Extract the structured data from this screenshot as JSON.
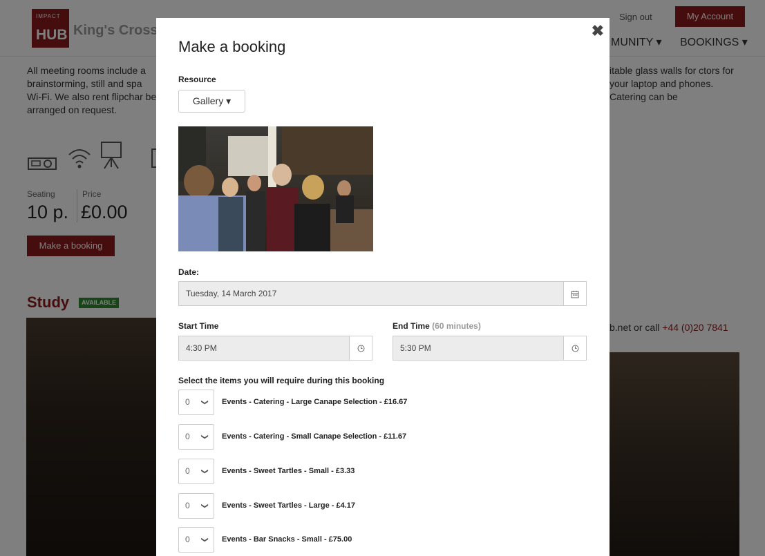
{
  "header": {
    "logo_small": "IMPACT",
    "logo_big": "HUB",
    "site_name": "King's Cross",
    "sign_out": "Sign out",
    "my_account": "My Account",
    "nav_community": "MUNITY ▾",
    "nav_bookings": "BOOKINGS ▾"
  },
  "room": {
    "description_left": "All meeting rooms include a brainstorming, still and spa Wi-Fi. We also rent flipchar be arranged on request.",
    "description_right": "itable glass walls for ctors for your laptop and phones. Catering can be",
    "seating_label": "Seating",
    "seating_value": "10 p.",
    "price_label": "Price",
    "price_value": "£0.00",
    "book_button": "Make a booking"
  },
  "study": {
    "title": "Study",
    "badge": "AVAILABLE",
    "contact_prefix": "b.net or call ",
    "contact_phone": "+44 (0)20 7841"
  },
  "modal": {
    "title": "Make a booking",
    "close": "✖",
    "resource_label": "Resource",
    "resource_value": "Gallery ▾",
    "date_label": "Date:",
    "date_value": "Tuesday, 14 March 2017",
    "start_label": "Start Time",
    "start_value": "4:30 PM",
    "end_label": "End Time",
    "end_duration": "(60 minutes)",
    "end_value": "5:30 PM",
    "items_label": "Select the items you will require during this booking",
    "items": [
      {
        "qty": "0",
        "label": "Events - Catering - Large Canape Selection - £16.67"
      },
      {
        "qty": "0",
        "label": "Events - Catering - Small Canape Selection - £11.67"
      },
      {
        "qty": "0",
        "label": "Events - Sweet Tartles - Small - £3.33"
      },
      {
        "qty": "0",
        "label": "Events - Sweet Tartles - Large - £4.17"
      },
      {
        "qty": "0",
        "label": "Events - Bar Snacks - Small - £75.00"
      }
    ]
  },
  "icons": {
    "calendar": "calendar-icon",
    "clock": "clock-icon",
    "chevron": "chevron-down-icon"
  },
  "colors": {
    "brand": "#8b1a1a",
    "available": "#2e8b2e"
  }
}
